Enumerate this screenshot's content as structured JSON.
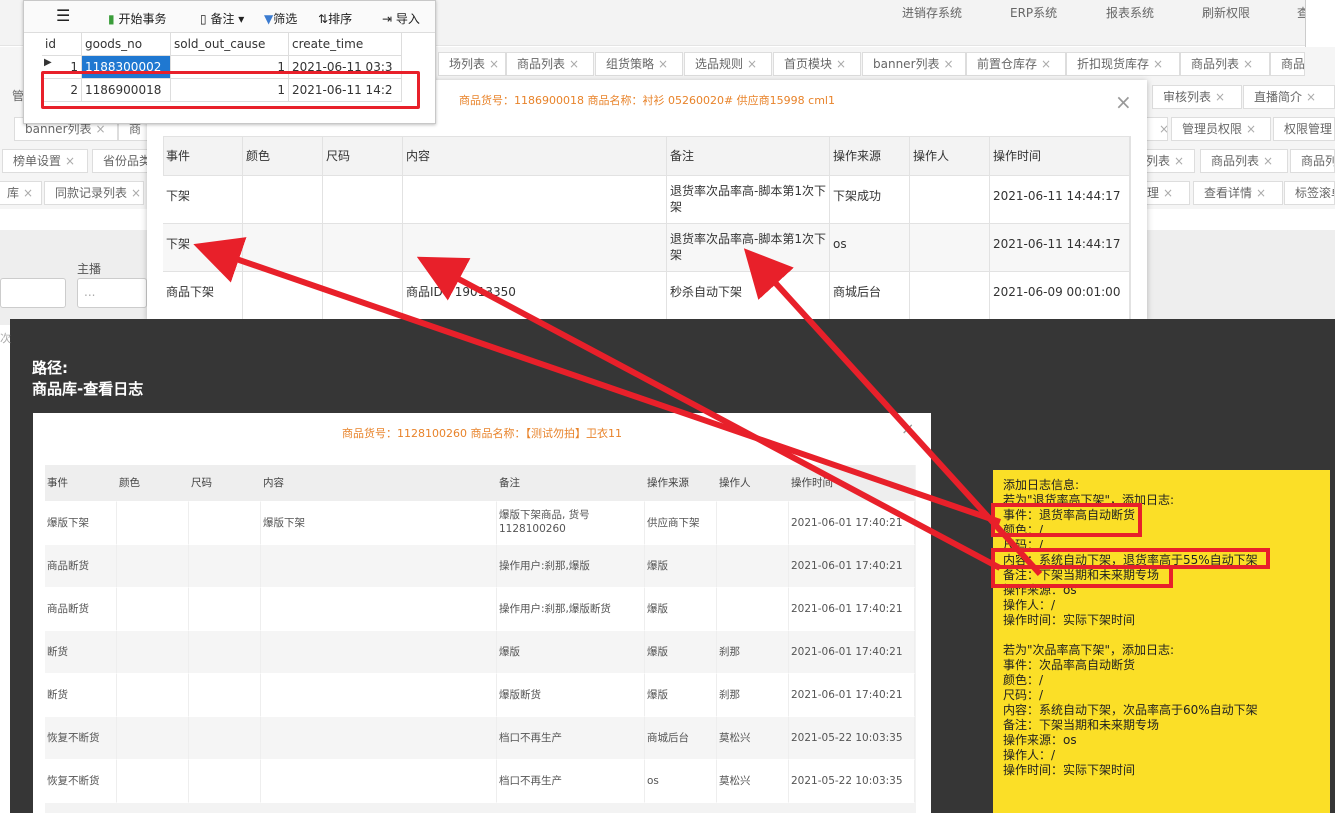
{
  "top_nav": [
    "进销存系统",
    "ERP系统",
    "报表系统",
    "刷新权限",
    "查"
  ],
  "tabs_row1": [
    "场列表",
    "商品列表",
    "组货策略",
    "选品规则",
    "首页模块",
    "banner列表",
    "前置仓库存",
    "折扣现货库存",
    "商品列表",
    "商品"
  ],
  "tabs_row2": [
    "审核列表",
    "直播简介"
  ],
  "tabs_row3": [
    "banner列表",
    "商",
    "管理员权限",
    "权限管理"
  ],
  "tabs_row4": [
    "榜单设置",
    "省份品类",
    "列表",
    "商品列表",
    "商品列"
  ],
  "tabs_row5": [
    "库",
    "同款记录列表",
    "理",
    "查看详情",
    "标签滚单"
  ],
  "side_labels": {
    "left_gray": "管",
    "zhubo": "主播",
    "select_dots": "...",
    "ci": "次"
  },
  "navicat": {
    "toolbar": {
      "begin_tx": "开始事务",
      "note": "备注",
      "filter": "筛选",
      "sort": "排序",
      "import": "导入"
    },
    "columns": [
      "id",
      "goods_no",
      "sold_out_cause",
      "create_time"
    ],
    "rows": [
      [
        "1",
        "1188300002",
        "1",
        "2021-06-11 03:3"
      ],
      [
        "2",
        "1186900018",
        "1",
        "2021-06-11 14:2"
      ]
    ]
  },
  "modal1": {
    "title": "商品货号：1186900018 商品名称：衬衫 05260020# 供应商15998 cml1",
    "close": "×",
    "columns": [
      "事件",
      "颜色",
      "尺码",
      "内容",
      "备注",
      "操作来源",
      "操作人",
      "操作时间"
    ],
    "rows": [
      [
        "下架",
        "",
        "",
        "",
        "退货率次品率高-脚本第1次下架",
        "下架成功",
        "",
        "2021-06-11 14:44:17"
      ],
      [
        "下架",
        "",
        "",
        "",
        "退货率次品率高-脚本第1次下架",
        "os",
        "",
        "2021-06-11 14:44:17"
      ],
      [
        "商品下架",
        "",
        "",
        "商品ID：19013350",
        "秒杀自动下架",
        "商城后台",
        "",
        "2021-06-09 00:01:00"
      ]
    ]
  },
  "overlay": {
    "path_label": "路径:",
    "path_value": "商品库-查看日志",
    "modal2": {
      "title": "商品货号：1128100260 商品名称：【测试勿拍】卫衣11",
      "close": "×",
      "columns": [
        "事件",
        "颜色",
        "尺码",
        "内容",
        "备注",
        "操作来源",
        "操作人",
        "操作时间"
      ],
      "rows": [
        [
          "爆版下架",
          "",
          "",
          "爆版下架",
          "爆版下架商品, 货号1128100260",
          "供应商下架",
          "",
          "2021-06-01 17:40:21"
        ],
        [
          "商品断货",
          "",
          "",
          "",
          "操作用户:刹那,爆版",
          "爆版",
          "",
          "2021-06-01 17:40:21"
        ],
        [
          "商品断货",
          "",
          "",
          "",
          "操作用户:刹那,爆版断货",
          "爆版",
          "",
          "2021-06-01 17:40:21"
        ],
        [
          "断货",
          "",
          "",
          "",
          "爆版",
          "爆版",
          "刹那",
          "2021-06-01 17:40:21"
        ],
        [
          "断货",
          "",
          "",
          "",
          "爆版断货",
          "爆版",
          "刹那",
          "2021-06-01 17:40:21"
        ],
        [
          "恢复不断货",
          "",
          "",
          "",
          "档口不再生产",
          "商城后台",
          "莫松兴",
          "2021-05-22 10:03:35"
        ],
        [
          "恢复不断货",
          "",
          "",
          "",
          "档口不再生产",
          "os",
          "莫松兴",
          "2021-05-22 10:03:35"
        ]
      ]
    },
    "note_lines": [
      "添加日志信息:",
      "若为\"退货率高下架\"，添加日志:",
      "事件：退货率高自动断货",
      "颜色：/",
      "尺码：/",
      "内容：系统自动下架，退货率高于55%自动下架",
      "备注：下架当期和未来期专场",
      "操作来源：os",
      "操作人：/",
      "操作时间：实际下架时间",
      "",
      "若为\"次品率高下架\"，添加日志:",
      "事件：次品率高自动断货",
      "颜色：/",
      "尺码：/",
      "内容：系统自动下架，次品率高于60%自动下架",
      "备注：下架当期和未来期专场",
      "操作来源：os",
      "操作人：/",
      "操作时间：实际下架时间"
    ]
  },
  "colors": {
    "annotation_red": "#e8202a",
    "note_yellow": "#fbdf27",
    "title_orange": "#e8832a",
    "overlay_dark": "#363636"
  }
}
